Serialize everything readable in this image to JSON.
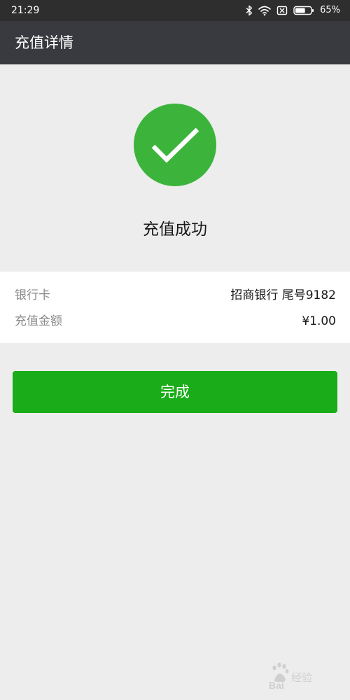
{
  "status_bar": {
    "time": "21:29",
    "battery_percent": "65%",
    "icons": [
      "bluetooth-icon",
      "wifi-icon",
      "no-sim-icon",
      "battery-icon"
    ],
    "battery_level": 0.65
  },
  "header": {
    "title": "充值详情"
  },
  "result": {
    "icon": "checkmark-icon",
    "message": "充值成功"
  },
  "details": [
    {
      "label": "银行卡",
      "value": "招商银行 尾号9182"
    },
    {
      "label": "充值金额",
      "value": "¥1.00"
    }
  ],
  "actions": {
    "done_label": "完成"
  },
  "watermark": {
    "text": "Baidu经验"
  },
  "colors": {
    "status_bar_bg": "#2e2e2e",
    "title_bar_bg": "#393a3f",
    "page_bg": "#ededed",
    "success_green": "#3cb43c",
    "button_green": "#1aad19"
  }
}
